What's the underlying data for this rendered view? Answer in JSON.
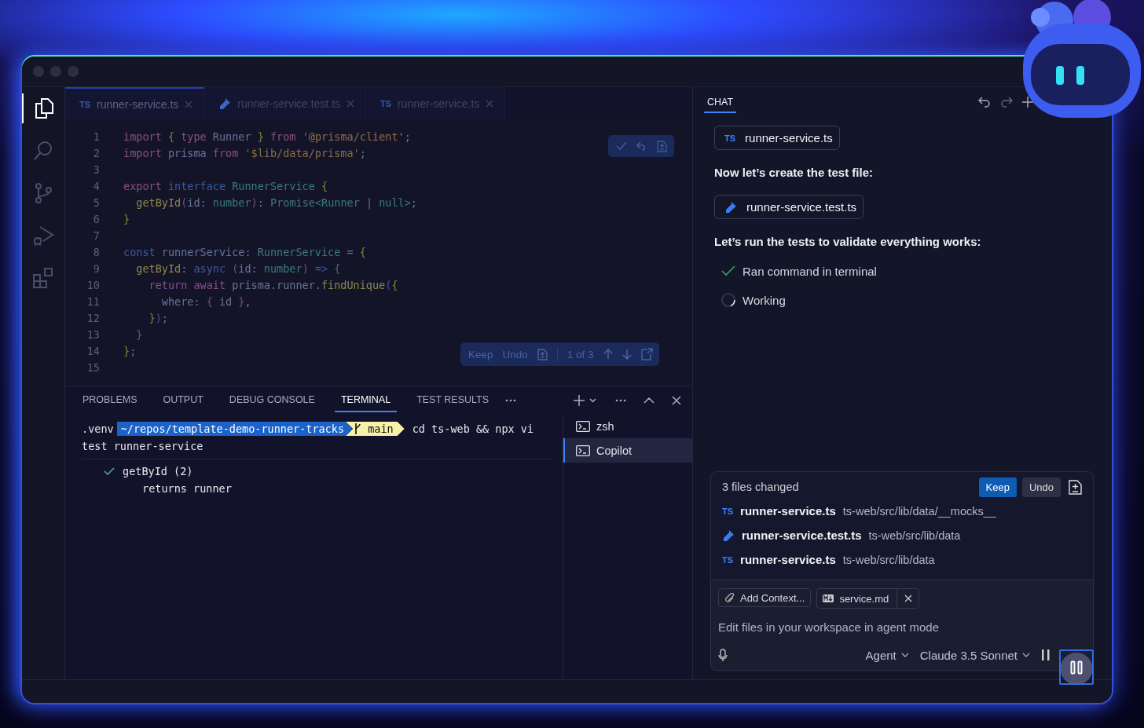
{
  "activity_bar": [
    {
      "kind": "files",
      "selected": true
    },
    {
      "kind": "search",
      "selected": false
    },
    {
      "kind": "source-control",
      "selected": false
    },
    {
      "kind": "run-debug",
      "selected": false
    },
    {
      "kind": "extensions",
      "selected": false
    }
  ],
  "editor": {
    "tabs": [
      {
        "kind": "ts",
        "badge": "TS",
        "label": "runner-service.ts",
        "selected": true
      },
      {
        "kind": "test",
        "label": "runner-service.test.ts",
        "selected": false
      },
      {
        "kind": "ts",
        "badge": "TS",
        "label": "runner-service.ts",
        "selected": false
      }
    ],
    "lines": [
      {
        "number": "1",
        "tokens": [
          {
            "kind": "kw",
            "text": "import "
          },
          {
            "kind": "punct",
            "text": "{ "
          },
          {
            "kind": "kw",
            "text": "type"
          },
          {
            "kind": "plain",
            "text": " Runner "
          },
          {
            "kind": "punct",
            "text": "} "
          },
          {
            "kind": "kw",
            "text": "from "
          },
          {
            "kind": "str",
            "text": "'@prisma/client'"
          },
          {
            "kind": "plain",
            "text": ";"
          }
        ]
      },
      {
        "number": "2",
        "tokens": [
          {
            "kind": "kw",
            "text": "import"
          },
          {
            "kind": "plain",
            "text": " prisma "
          },
          {
            "kind": "kw",
            "text": "from "
          },
          {
            "kind": "str",
            "text": "'$lib/data/prisma'"
          },
          {
            "kind": "plain",
            "text": ";"
          }
        ]
      },
      {
        "number": "3"
      },
      {
        "number": "4",
        "tokens": [
          {
            "kind": "kw",
            "text": "export "
          },
          {
            "kind": "decl",
            "text": "interface "
          },
          {
            "kind": "type",
            "text": "RunnerService "
          },
          {
            "kind": "punct",
            "text": "{"
          }
        ]
      },
      {
        "number": "5",
        "tokens": [
          {
            "kind": "fn",
            "text": "  getById"
          },
          {
            "kind": "paren",
            "text": "("
          },
          {
            "kind": "plain",
            "text": "id: "
          },
          {
            "kind": "type",
            "text": "number"
          },
          {
            "kind": "paren",
            "text": ")"
          },
          {
            "kind": "plain",
            "text": ": "
          },
          {
            "kind": "type",
            "text": "Promise<Runner"
          },
          {
            "kind": "plain",
            "text": " | "
          },
          {
            "kind": "type",
            "text": "null>"
          },
          {
            "kind": "plain",
            "text": ";"
          }
        ]
      },
      {
        "number": "6",
        "tokens": [
          {
            "kind": "punct",
            "text": "}"
          }
        ]
      },
      {
        "number": "7"
      },
      {
        "number": "8",
        "tokens": [
          {
            "kind": "decl",
            "text": "const"
          },
          {
            "kind": "plain",
            "text": " runnerService: "
          },
          {
            "kind": "type",
            "text": "RunnerService"
          },
          {
            "kind": "plain",
            "text": " = "
          },
          {
            "kind": "punct",
            "text": "{"
          }
        ]
      },
      {
        "number": "9",
        "tokens": [
          {
            "kind": "fn",
            "text": "  getById"
          },
          {
            "kind": "plain",
            "text": ": "
          },
          {
            "kind": "decl",
            "text": "async "
          },
          {
            "kind": "paren",
            "text": "("
          },
          {
            "kind": "plain",
            "text": "id: "
          },
          {
            "kind": "type",
            "text": "number"
          },
          {
            "kind": "paren",
            "text": ") "
          },
          {
            "kind": "decl",
            "text": "=> "
          },
          {
            "kind": "paren",
            "text": "{"
          }
        ]
      },
      {
        "number": "10",
        "tokens": [
          {
            "kind": "kw",
            "text": "    return await"
          },
          {
            "kind": "plain",
            "text": " prisma.runner."
          },
          {
            "kind": "fn",
            "text": "findUnique"
          },
          {
            "kind": "decl",
            "text": "("
          },
          {
            "kind": "punct",
            "text": "{"
          }
        ]
      },
      {
        "number": "11",
        "tokens": [
          {
            "kind": "plain",
            "text": "      where: "
          },
          {
            "kind": "paren",
            "text": "{"
          },
          {
            "kind": "plain",
            "text": " id "
          },
          {
            "kind": "paren",
            "text": "}"
          },
          {
            "kind": "plain",
            "text": ","
          }
        ]
      },
      {
        "number": "12",
        "tokens": [
          {
            "kind": "punct",
            "text": "    }"
          },
          {
            "kind": "decl",
            "text": ")"
          },
          {
            "kind": "plain",
            "text": ";"
          }
        ]
      },
      {
        "number": "13",
        "tokens": [
          {
            "kind": "paren",
            "text": "  }"
          }
        ]
      },
      {
        "number": "14",
        "tokens": [
          {
            "kind": "punct",
            "text": "}"
          },
          {
            "kind": "plain",
            "text": ";"
          }
        ]
      },
      {
        "number": "15"
      }
    ],
    "diff_toolbar": {
      "keep": "Keep",
      "undo": "Undo",
      "counter": "1 of 3"
    }
  },
  "panel": {
    "tabs": [
      {
        "label": "PROBLEMS",
        "selected": false
      },
      {
        "label": "OUTPUT",
        "selected": false
      },
      {
        "label": "DEBUG CONSOLE",
        "selected": false
      },
      {
        "label": "TERMINAL",
        "selected": true
      },
      {
        "label": "TEST RESULTS",
        "selected": false
      }
    ],
    "terminal": {
      "venv": ".venv",
      "path": "~/repos/template-demo-runner-tracks",
      "branch": "main",
      "command": "cd ts-web && npx vi",
      "continuation": "test runner-service",
      "output": [
        {
          "kind": "suite",
          "text": "getById (2)",
          "passed": true
        },
        {
          "kind": "test",
          "text": "returns runner"
        }
      ]
    },
    "terminals": [
      {
        "label": "zsh",
        "selected": false
      },
      {
        "label": "Copilot",
        "selected": true
      }
    ]
  },
  "chat": {
    "tab": {
      "label": "CHAT",
      "selected": true
    },
    "messages": [
      {
        "kind": "ts-file",
        "badge": "TS",
        "label": "runner-service.ts"
      },
      {
        "kind": "text",
        "text": "Now let’s create the test file:"
      },
      {
        "kind": "test-file",
        "label": "runner-service.test.ts"
      },
      {
        "kind": "text",
        "text": "Let’s run the tests to validate everything works:"
      },
      {
        "kind": "step",
        "done": true,
        "text": "Ran command in terminal"
      },
      {
        "kind": "step",
        "done": false,
        "text": "Working"
      }
    ],
    "changes": {
      "title": "3 files changed",
      "keep": "Keep",
      "undo": "Undo",
      "files": [
        {
          "kind": "ts",
          "badge": "TS",
          "name": "runner-service.ts",
          "path": "ts-web/src/lib/data/__mocks__"
        },
        {
          "kind": "test",
          "name": "runner-service.test.ts",
          "path": "ts-web/src/lib/data"
        },
        {
          "kind": "ts",
          "badge": "TS",
          "name": "runner-service.ts",
          "path": "ts-web/src/lib/data"
        }
      ]
    },
    "input": {
      "chips": [
        {
          "kind": "add",
          "label": "Add Context..."
        },
        {
          "kind": "file",
          "label": "service.md"
        }
      ],
      "placeholder": "Edit files in your workspace in agent mode",
      "mode": "Agent",
      "model": "Claude 3.5 Sonnet"
    }
  }
}
